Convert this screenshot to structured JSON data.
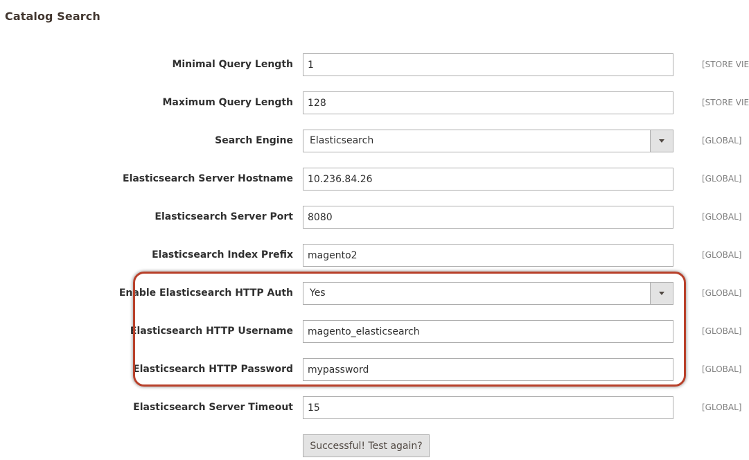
{
  "section": {
    "title": "Catalog Search"
  },
  "fields": {
    "min_query_length": {
      "label": "Minimal Query Length",
      "value": "1",
      "scope": "[STORE VIEW]"
    },
    "max_query_length": {
      "label": "Maximum Query Length",
      "value": "128",
      "scope": "[STORE VIEW]"
    },
    "search_engine": {
      "label": "Search Engine",
      "value": "Elasticsearch",
      "scope": "[GLOBAL]"
    },
    "es_hostname": {
      "label": "Elasticsearch Server Hostname",
      "value": "10.236.84.26",
      "scope": "[GLOBAL]"
    },
    "es_port": {
      "label": "Elasticsearch Server Port",
      "value": "8080",
      "scope": "[GLOBAL]"
    },
    "es_index_prefix": {
      "label": "Elasticsearch Index Prefix",
      "value": "magento2",
      "scope": "[GLOBAL]"
    },
    "es_http_auth": {
      "label": "Enable Elasticsearch HTTP Auth",
      "value": "Yes",
      "scope": "[GLOBAL]"
    },
    "es_username": {
      "label": "Elasticsearch HTTP Username",
      "value": "magento_elasticsearch",
      "scope": "[GLOBAL]"
    },
    "es_password": {
      "label": "Elasticsearch HTTP Password",
      "value": "mypassword",
      "scope": "[GLOBAL]"
    },
    "es_timeout": {
      "label": "Elasticsearch Server Timeout",
      "value": "15",
      "scope": "[GLOBAL]"
    }
  },
  "test_connection": {
    "label": "Successful! Test again?"
  },
  "colors": {
    "highlight_border": "#b8402a",
    "button_bg": "#e3e3e3",
    "input_border": "#adadad"
  }
}
